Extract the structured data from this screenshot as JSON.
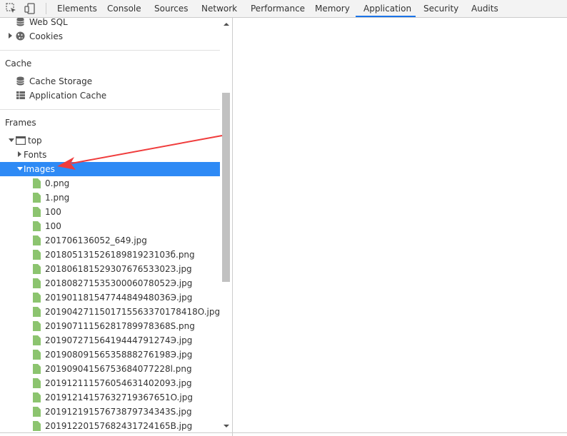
{
  "toolbar": {
    "tabs": [
      {
        "label": "Elements"
      },
      {
        "label": "Console"
      },
      {
        "label": "Sources"
      },
      {
        "label": "Network"
      },
      {
        "label": "Performance"
      },
      {
        "label": "Memory"
      },
      {
        "label": "Application",
        "active": true
      },
      {
        "label": "Security"
      },
      {
        "label": "Audits"
      }
    ],
    "accent_color": "#1a73e8"
  },
  "sidebar": {
    "top_items": [
      {
        "label": "Web SQL",
        "icon": "database-icon"
      },
      {
        "label": "Cookies",
        "icon": "cookie-icon"
      }
    ],
    "cache": {
      "title": "Cache",
      "items": [
        {
          "label": "Cache Storage",
          "icon": "database-icon"
        },
        {
          "label": "Application Cache",
          "icon": "grid-icon"
        }
      ]
    },
    "frames": {
      "title": "Frames",
      "top_label": "top",
      "fonts_label": "Fonts",
      "images_label": "Images",
      "files": [
        "0.png",
        "1.png",
        "100",
        "100",
        "201706136052_649.jpg",
        "20180513152618981923103б.png",
        "20180618152930767653302З.jpg",
        "20180827153530006078052Э.jpg",
        "20190118154774484948036Э.jpg",
        "2019042711501715563370178418O.jpg",
        "20190711156281789978368S.png",
        "20190727156419444791274Э.jpg",
        "20190809156535888276198Э.jpg",
        "20190904156753684077228l.png",
        "20191211157605463140209З.jpg",
        "20191214157632719367651O.jpg",
        "20191219157673879734343S.jpg",
        "20191220157682431724165B.jpg"
      ],
      "selected_color": "#2e8af5",
      "file_icon_color": "#8cc46f"
    }
  },
  "annotation": {
    "color": "#f03c3c"
  }
}
